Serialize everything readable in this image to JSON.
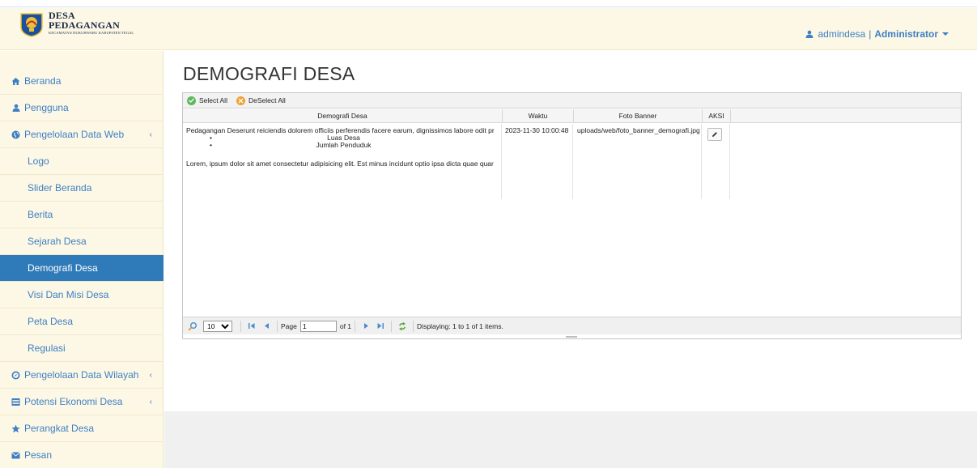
{
  "brand": {
    "line1": "DESA",
    "line2": "PEDAGANGAN",
    "line3": "KECAMATAN DUKUHWARU KABUPATEN TEGAL"
  },
  "user": {
    "name": "admindesa",
    "role": "Administrator"
  },
  "sidebar": {
    "items": [
      {
        "label": "Beranda",
        "icon": "home-icon"
      },
      {
        "label": "Pengguna",
        "icon": "user-icon"
      },
      {
        "label": "Pengelolaan Data Web",
        "icon": "globe-icon"
      },
      {
        "label": "Logo"
      },
      {
        "label": "Slider Beranda"
      },
      {
        "label": "Berita"
      },
      {
        "label": "Sejarah Desa"
      },
      {
        "label": "Demografi Desa"
      },
      {
        "label": "Visi Dan Misi Desa"
      },
      {
        "label": "Peta Desa"
      },
      {
        "label": "Regulasi"
      },
      {
        "label": "Pengelolaan Data Wilayah",
        "icon": "compass-icon"
      },
      {
        "label": "Potensi Ekonomi Desa",
        "icon": "list-icon"
      },
      {
        "label": "Perangkat Desa",
        "icon": "star-icon"
      },
      {
        "label": "Pesan",
        "icon": "envelope-icon"
      }
    ],
    "active": "Demografi Desa"
  },
  "page": {
    "title": "DEMOGRAFI DESA"
  },
  "grid": {
    "toolbar": {
      "select_all": "Select All",
      "deselect_all": "DeSelect All"
    },
    "columns": [
      "Demografi Desa",
      "Waktu",
      "Foto Banner",
      "AKSI"
    ],
    "rows": [
      {
        "demografi_line1": "Pedagangan  Deserunt reiciendis dolorem officiis perferendis facere earum, dignissimos labore odit pr",
        "bullet1": "Luas Desa",
        "bullet2": "Jumlah Penduduk",
        "paragraph": "Lorem, ipsum dolor sit amet consectetur adipisicing elit. Est minus incidunt optio ipsa dicta quae quar",
        "waktu": "2023-11-30 10:00:48",
        "foto_banner": "uploads/web/foto_banner_demografi.jpg"
      }
    ],
    "pager": {
      "page_size": "10",
      "page_label": "Page",
      "page_value": "1",
      "of_label": "of 1",
      "displaying": "Displaying: 1 to 1 of 1 items."
    }
  },
  "colors": {
    "accent": "#2f7ab9",
    "link": "#3d7fc4",
    "sidebar_bg": "#fdf8e5"
  }
}
